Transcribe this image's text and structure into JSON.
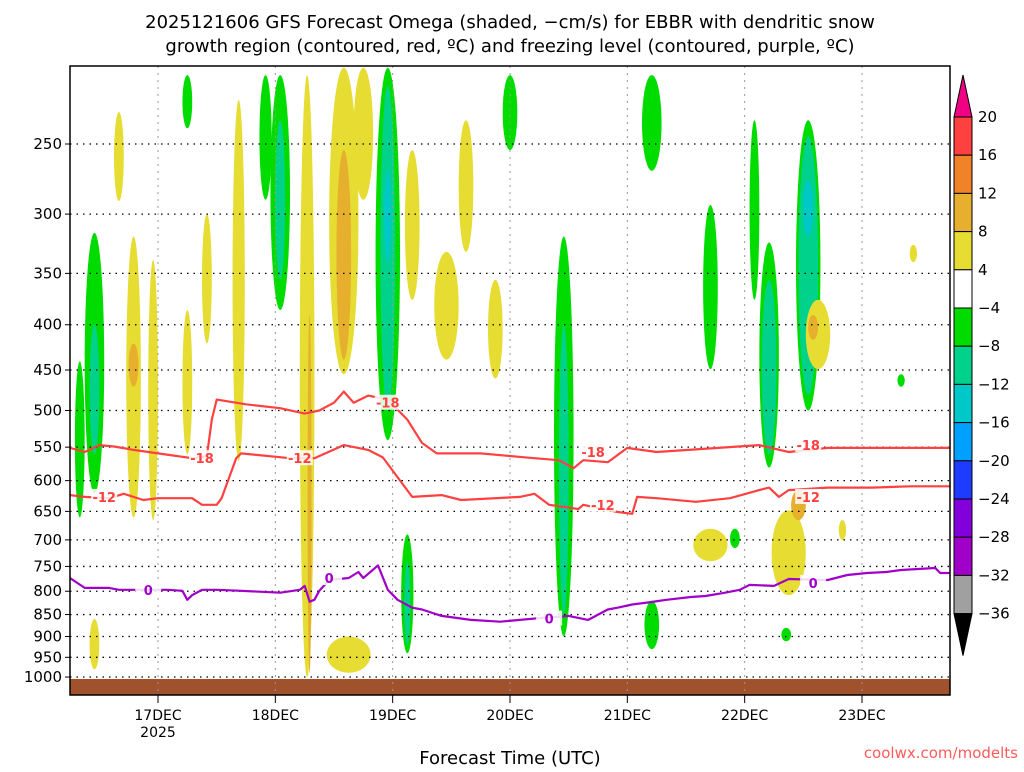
{
  "chart_data": {
    "type": "heatmap",
    "title_line1": "2025121606 GFS Forecast Omega (shaded, −cm/s) for EBBR with dendritic snow",
    "title_line2": "growth region (contoured, red, ºC) and freezing level (contoured, purple, ºC)",
    "xlabel": "Forecast Time (UTC)",
    "ylabel": "",
    "x_units": "forecast hours from 2025-12-16 06Z",
    "xlim": [
      0,
      180
    ],
    "ylim_pressure": [
      1050,
      204
    ],
    "y_scale": "log",
    "y_ticks": [
      250,
      300,
      350,
      400,
      450,
      500,
      550,
      600,
      650,
      700,
      750,
      800,
      850,
      900,
      950,
      1000
    ],
    "x_ticks": [
      {
        "hour": 18,
        "label": "17DEC",
        "sublabel": "2025"
      },
      {
        "hour": 42,
        "label": "18DEC"
      },
      {
        "hour": 66,
        "label": "19DEC"
      },
      {
        "hour": 90,
        "label": "20DEC"
      },
      {
        "hour": 114,
        "label": "21DEC"
      },
      {
        "hour": 138,
        "label": "22DEC"
      },
      {
        "hour": 162,
        "label": "23DEC"
      }
    ],
    "grid": true,
    "credit": "coolwx.com/modelts",
    "surface_pressure": 1005,
    "surface_color": "#a0522d",
    "colorbar": {
      "labels": [
        "20",
        "16",
        "12",
        "8",
        "4",
        "−4",
        "−8",
        "−12",
        "−16",
        "−20",
        "−24",
        "−28",
        "−32",
        "−36"
      ],
      "over_color": "#f00082",
      "under_color": "#000000",
      "colors": [
        "#ff4040",
        "#f08228",
        "#e6af2d",
        "#e6dc32",
        "#ffffff",
        "#00dc00",
        "#00d28c",
        "#00c8c8",
        "#00a0ff",
        "#1e3cff",
        "#8200dc",
        "#a000c8",
        "#a0a0a0"
      ]
    },
    "shading_levels": {
      "4": "#e6dc32",
      "8": "#e6af2d",
      "12": "#f08228",
      "-8": "#00dc00",
      "-12": "#00d28c",
      "-16": "#00c8c8",
      "-20": "#00a0ff"
    },
    "omega_cells": [
      {
        "h": 5,
        "w": 4,
        "p1": 315,
        "p2": 620,
        "c": -8
      },
      {
        "h": 5,
        "w": 2,
        "p1": 400,
        "p2": 560,
        "c": -12
      },
      {
        "h": 2,
        "w": 2,
        "p1": 440,
        "p2": 660,
        "c": -8
      },
      {
        "h": 13,
        "w": 3,
        "p1": 318,
        "p2": 660,
        "c": 4
      },
      {
        "h": 13,
        "w": 2,
        "p1": 420,
        "p2": 470,
        "c": 8
      },
      {
        "h": 17,
        "w": 2,
        "p1": 338,
        "p2": 665,
        "c": 4
      },
      {
        "h": 24,
        "w": 2,
        "p1": 385,
        "p2": 560,
        "c": 4
      },
      {
        "h": 34.5,
        "w": 2.5,
        "p1": 223,
        "p2": 570,
        "c": 4
      },
      {
        "h": 40,
        "w": 2.5,
        "p1": 209,
        "p2": 289,
        "c": -8
      },
      {
        "h": 43,
        "w": 4,
        "p1": 209,
        "p2": 385,
        "c": -8
      },
      {
        "h": 43,
        "w": 2,
        "p1": 235,
        "p2": 356,
        "c": -12
      },
      {
        "h": 48.5,
        "w": 3,
        "p1": 209,
        "p2": 1000,
        "c": 4
      },
      {
        "h": 49,
        "w": 0.8,
        "p1": 390,
        "p2": 990,
        "c": 8
      },
      {
        "h": 56,
        "w": 6,
        "p1": 205,
        "p2": 455,
        "c": 4
      },
      {
        "h": 56,
        "w": 3,
        "p1": 254,
        "p2": 438,
        "c": 8
      },
      {
        "h": 60,
        "w": 4,
        "p1": 205,
        "p2": 289,
        "c": 4
      },
      {
        "h": 65,
        "w": 5,
        "p1": 205,
        "p2": 540,
        "c": -8
      },
      {
        "h": 65,
        "w": 3,
        "p1": 215,
        "p2": 500,
        "c": -12
      },
      {
        "h": 65,
        "w": 1.5,
        "p1": 268,
        "p2": 340,
        "c": -16
      },
      {
        "h": 70,
        "w": 3,
        "p1": 254,
        "p2": 375,
        "c": 4
      },
      {
        "h": 77,
        "w": 5,
        "p1": 331,
        "p2": 438,
        "c": 4
      },
      {
        "h": 81,
        "w": 3,
        "p1": 235,
        "p2": 331,
        "c": 4
      },
      {
        "h": 87,
        "w": 3,
        "p1": 356,
        "p2": 460,
        "c": 4
      },
      {
        "h": 90,
        "w": 3,
        "p1": 209,
        "p2": 254,
        "c": -8
      },
      {
        "h": 101,
        "w": 4,
        "p1": 318,
        "p2": 900,
        "c": -8
      },
      {
        "h": 101,
        "w": 2,
        "p1": 400,
        "p2": 850,
        "c": -12
      },
      {
        "h": 119,
        "w": 4,
        "p1": 209,
        "p2": 268,
        "c": -8
      },
      {
        "h": 131,
        "w": 3,
        "p1": 293,
        "p2": 449,
        "c": -8
      },
      {
        "h": 140,
        "w": 2,
        "p1": 235,
        "p2": 375,
        "c": -8
      },
      {
        "h": 143,
        "w": 4,
        "p1": 323,
        "p2": 580,
        "c": -8
      },
      {
        "h": 143,
        "w": 3,
        "p1": 356,
        "p2": 560,
        "c": -12
      },
      {
        "h": 151,
        "w": 5,
        "p1": 235,
        "p2": 500,
        "c": -8
      },
      {
        "h": 151,
        "w": 4,
        "p1": 245,
        "p2": 480,
        "c": -12
      },
      {
        "h": 151,
        "w": 2,
        "p1": 275,
        "p2": 318,
        "c": -16
      },
      {
        "h": 153,
        "w": 5,
        "p1": 375,
        "p2": 449,
        "c": 4
      },
      {
        "h": 152,
        "w": 2,
        "p1": 390,
        "p2": 416,
        "c": 8
      },
      {
        "h": 147,
        "w": 7,
        "p1": 648,
        "p2": 808,
        "c": 4
      },
      {
        "h": 149,
        "w": 3,
        "p1": 615,
        "p2": 665,
        "c": 8
      },
      {
        "h": 131,
        "w": 7,
        "p1": 680,
        "p2": 740,
        "c": 4
      },
      {
        "h": 136,
        "w": 2,
        "p1": 680,
        "p2": 715,
        "c": -8
      },
      {
        "h": 57,
        "w": 9,
        "p1": 900,
        "p2": 989,
        "c": 4
      },
      {
        "h": 5,
        "w": 2,
        "p1": 860,
        "p2": 980,
        "c": 4
      },
      {
        "h": 69,
        "w": 2.5,
        "p1": 690,
        "p2": 940,
        "c": -8
      },
      {
        "h": 69,
        "w": 1.2,
        "p1": 740,
        "p2": 920,
        "c": -12
      },
      {
        "h": 119,
        "w": 3,
        "p1": 820,
        "p2": 930,
        "c": -8
      },
      {
        "h": 158,
        "w": 1.5,
        "p1": 665,
        "p2": 700,
        "c": 4
      },
      {
        "h": 170,
        "w": 1.5,
        "p1": 455,
        "p2": 470,
        "c": -8
      },
      {
        "h": 172.5,
        "w": 1.5,
        "p1": 325,
        "p2": 340,
        "c": 4
      },
      {
        "h": 146.5,
        "w": 2,
        "p1": 880,
        "p2": 911,
        "c": -8
      },
      {
        "h": 24,
        "w": 2,
        "p1": 209,
        "p2": 240,
        "c": -8
      },
      {
        "h": 10,
        "w": 2,
        "p1": 230,
        "p2": 290,
        "c": 4
      },
      {
        "h": 28,
        "w": 2,
        "p1": 300,
        "p2": 420,
        "c": 4
      }
    ],
    "contours": [
      {
        "name": "-18",
        "color": "#ff4040",
        "points": [
          [
            0,
            551
          ],
          [
            3,
            557
          ],
          [
            6,
            547
          ],
          [
            9,
            549
          ],
          [
            13,
            554
          ],
          [
            18,
            559
          ],
          [
            25,
            566
          ],
          [
            28,
            563
          ],
          [
            29,
            512
          ],
          [
            30,
            486
          ],
          [
            36,
            492
          ],
          [
            43,
            497
          ],
          [
            48,
            504
          ],
          [
            51,
            500
          ],
          [
            54,
            490
          ],
          [
            56,
            476
          ],
          [
            58,
            490
          ],
          [
            61,
            481
          ],
          [
            65,
            486
          ],
          [
            69,
            512
          ],
          [
            72,
            544
          ],
          [
            75,
            559
          ],
          [
            84,
            559
          ],
          [
            95,
            566
          ],
          [
            100,
            569
          ],
          [
            103,
            581
          ],
          [
            105,
            569
          ],
          [
            110,
            572
          ],
          [
            114,
            551
          ],
          [
            120,
            557
          ],
          [
            141,
            547
          ],
          [
            147,
            557
          ],
          [
            155,
            551
          ],
          [
            180,
            551
          ]
        ],
        "labels": [
          [
            27,
            566
          ],
          [
            65,
            490
          ],
          [
            107,
            557
          ],
          [
            151,
            547
          ]
        ]
      },
      {
        "name": "-12",
        "color": "#ff4040",
        "points": [
          [
            0,
            623
          ],
          [
            3,
            626
          ],
          [
            8,
            628
          ],
          [
            11,
            621
          ],
          [
            15,
            631
          ],
          [
            18,
            628
          ],
          [
            25,
            628
          ],
          [
            27,
            639
          ],
          [
            30,
            639
          ],
          [
            31,
            628
          ],
          [
            34,
            566
          ],
          [
            35,
            559
          ],
          [
            45,
            566
          ],
          [
            50,
            566
          ],
          [
            56,
            547
          ],
          [
            61,
            554
          ],
          [
            64,
            565
          ],
          [
            70,
            626
          ],
          [
            76,
            623
          ],
          [
            80,
            631
          ],
          [
            92,
            626
          ],
          [
            95,
            621
          ],
          [
            98,
            639
          ],
          [
            104,
            646
          ],
          [
            105,
            639
          ],
          [
            112,
            651
          ],
          [
            115,
            654
          ],
          [
            116,
            626
          ],
          [
            120,
            628
          ],
          [
            128,
            634
          ],
          [
            135,
            628
          ],
          [
            141,
            615
          ],
          [
            143,
            611
          ],
          [
            145,
            626
          ],
          [
            147,
            615
          ],
          [
            155,
            611
          ],
          [
            164,
            611
          ],
          [
            172,
            609
          ],
          [
            180,
            609
          ]
        ],
        "labels": [
          [
            7,
            626
          ],
          [
            47,
            566
          ],
          [
            109,
            639
          ],
          [
            151,
            626
          ]
        ]
      },
      {
        "name": "0",
        "color": "#a000c8",
        "points": [
          [
            0,
            773
          ],
          [
            3,
            793
          ],
          [
            8,
            793
          ],
          [
            10,
            797
          ],
          [
            14,
            797
          ],
          [
            20,
            797
          ],
          [
            23,
            799
          ],
          [
            24,
            818
          ],
          [
            25,
            808
          ],
          [
            27,
            797
          ],
          [
            30,
            797
          ],
          [
            35,
            799
          ],
          [
            43,
            803
          ],
          [
            47,
            797
          ],
          [
            48,
            789
          ],
          [
            49,
            822
          ],
          [
            50,
            818
          ],
          [
            51,
            799
          ],
          [
            53,
            777
          ],
          [
            57,
            773
          ],
          [
            59,
            761
          ],
          [
            60,
            773
          ],
          [
            63,
            748
          ],
          [
            65,
            797
          ],
          [
            67,
            818
          ],
          [
            70,
            835
          ],
          [
            72,
            839
          ],
          [
            76,
            853
          ],
          [
            82,
            862
          ],
          [
            88,
            866
          ],
          [
            92,
            862
          ],
          [
            97,
            857
          ],
          [
            100,
            855
          ],
          [
            102,
            853
          ],
          [
            106,
            862
          ],
          [
            110,
            839
          ],
          [
            112,
            835
          ],
          [
            115,
            828
          ],
          [
            118,
            824
          ],
          [
            122,
            818
          ],
          [
            127,
            812
          ],
          [
            130,
            810
          ],
          [
            134,
            803
          ],
          [
            137,
            797
          ],
          [
            139,
            787
          ],
          [
            144,
            789
          ],
          [
            147,
            775
          ],
          [
            155,
            777
          ],
          [
            159,
            767
          ],
          [
            163,
            763
          ],
          [
            167,
            761
          ],
          [
            170,
            757
          ],
          [
            177,
            753
          ],
          [
            178,
            763
          ],
          [
            180,
            763
          ]
        ],
        "labels": [
          [
            16,
            797
          ],
          [
            53,
            773
          ],
          [
            98,
            859
          ],
          [
            152,
            783
          ]
        ]
      }
    ]
  }
}
